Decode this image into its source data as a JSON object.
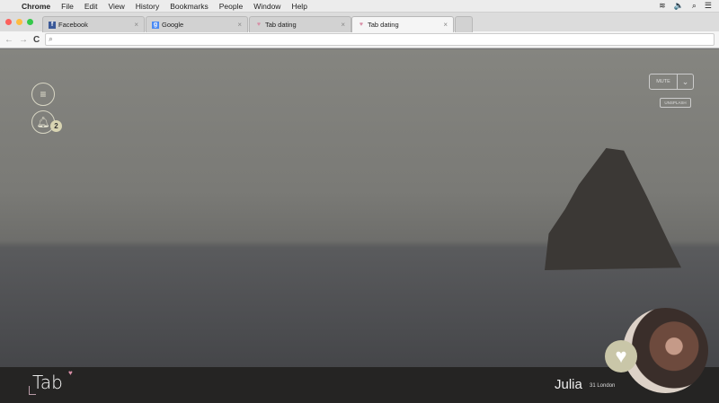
{
  "menubar": {
    "app": "Chrome",
    "items": [
      "File",
      "Edit",
      "View",
      "History",
      "Bookmarks",
      "People",
      "Window",
      "Help"
    ]
  },
  "tabs": [
    {
      "label": "Facebook",
      "icon": "facebook-icon"
    },
    {
      "label": "Google",
      "icon": "google-icon"
    },
    {
      "label": "Tab dating",
      "icon": "heart-icon"
    },
    {
      "label": "Tab dating",
      "icon": "heart-icon",
      "active": true
    }
  ],
  "tab_close": "×",
  "page": {
    "notification_count": "2",
    "mute_label": "MUTE",
    "unsplash_label": "UNSPLASH",
    "logo": "Tab",
    "profile": {
      "name": "Julia",
      "meta": "31 London"
    }
  },
  "colors": {
    "footer": "#252423",
    "accent": "#d88ea6",
    "like": "#c9c6a8"
  }
}
